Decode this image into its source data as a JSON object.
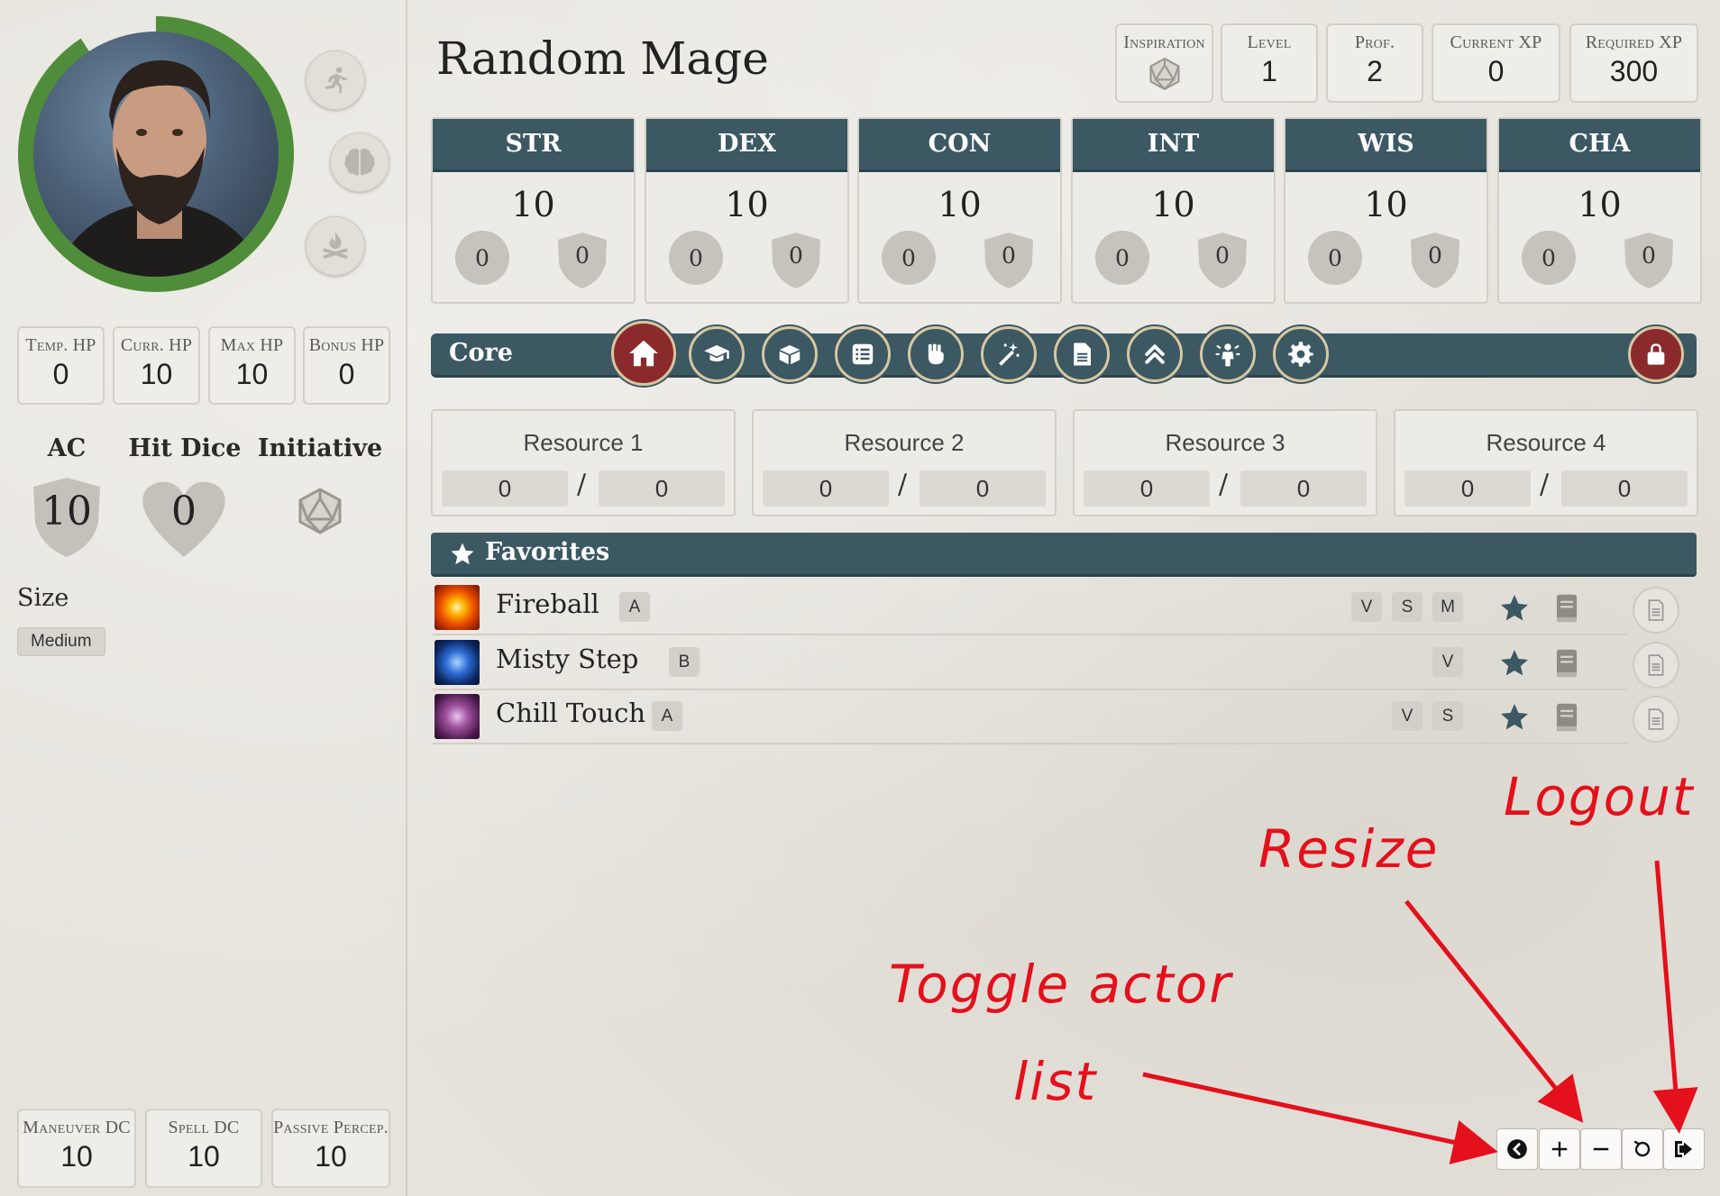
{
  "character": {
    "name": "Random Mage",
    "portrait_icon": "portrait-image",
    "side_icons": [
      "running-icon",
      "brain-icon",
      "campfire-icon"
    ]
  },
  "top_stats": [
    {
      "label": "Inspiration",
      "value": "",
      "icon": "d20-icon"
    },
    {
      "label": "Level",
      "value": "1"
    },
    {
      "label": "Prof.",
      "value": "2"
    },
    {
      "label": "Current XP",
      "value": "0"
    },
    {
      "label": "Required XP",
      "value": "300"
    }
  ],
  "hp": [
    {
      "label": "Temp. HP",
      "value": "0"
    },
    {
      "label": "Curr. HP",
      "value": "10"
    },
    {
      "label": "Max HP",
      "value": "10"
    },
    {
      "label": "Bonus HP",
      "value": "0"
    }
  ],
  "combat": {
    "ac_label": "AC",
    "ac_value": "10",
    "hit_dice_label": "Hit Dice",
    "hit_dice_value": "0",
    "initiative_label": "Initiative"
  },
  "size": {
    "label": "Size",
    "value": "Medium"
  },
  "dcs": [
    {
      "label": "Maneuver DC",
      "value": "10"
    },
    {
      "label": "Spell DC",
      "value": "10"
    },
    {
      "label": "Passive Percep.",
      "value": "10"
    }
  ],
  "abilities": [
    {
      "abbr": "STR",
      "score": "10",
      "mod": "0",
      "save": "0"
    },
    {
      "abbr": "DEX",
      "score": "10",
      "mod": "0",
      "save": "0"
    },
    {
      "abbr": "CON",
      "score": "10",
      "mod": "0",
      "save": "0"
    },
    {
      "abbr": "INT",
      "score": "10",
      "mod": "0",
      "save": "0"
    },
    {
      "abbr": "WIS",
      "score": "10",
      "mod": "0",
      "save": "0"
    },
    {
      "abbr": "CHA",
      "score": "10",
      "mod": "0",
      "save": "0"
    }
  ],
  "nav": {
    "label": "Core",
    "tabs": [
      "home-icon",
      "graduation-cap-icon",
      "box-icon",
      "list-icon",
      "fist-icon",
      "magic-wand-icon",
      "document-icon",
      "chevrons-up-icon",
      "person-icon",
      "gear-icon"
    ],
    "lock": "lock-icon"
  },
  "resources": [
    {
      "name": "Resource 1",
      "current": "0",
      "max": "0"
    },
    {
      "name": "Resource 2",
      "current": "0",
      "max": "0"
    },
    {
      "name": "Resource 3",
      "current": "0",
      "max": "0"
    },
    {
      "name": "Resource 4",
      "current": "0",
      "max": "0"
    }
  ],
  "favorites": {
    "title": "Favorites",
    "items": [
      {
        "name": "Fireball",
        "tag": "A",
        "components": [
          "V",
          "S",
          "M"
        ]
      },
      {
        "name": "Misty Step",
        "tag": "B",
        "components": [
          "V"
        ]
      },
      {
        "name": "Chill Touch",
        "tag": "A",
        "components": [
          "V",
          "S"
        ]
      }
    ]
  },
  "controls": [
    "toggle-actor-list-icon",
    "zoom-in-icon",
    "zoom-out-icon",
    "reset-icon",
    "logout-icon"
  ],
  "annotations": {
    "logout": "Logout",
    "resize": "Resize",
    "toggle_line1": "Toggle actor",
    "toggle_line2": "list"
  },
  "colors": {
    "teal": "#3b5863",
    "accent_red": "#8b2a2c",
    "hp_ring": "#4f8d3a",
    "annotation_red": "#e4101c"
  }
}
